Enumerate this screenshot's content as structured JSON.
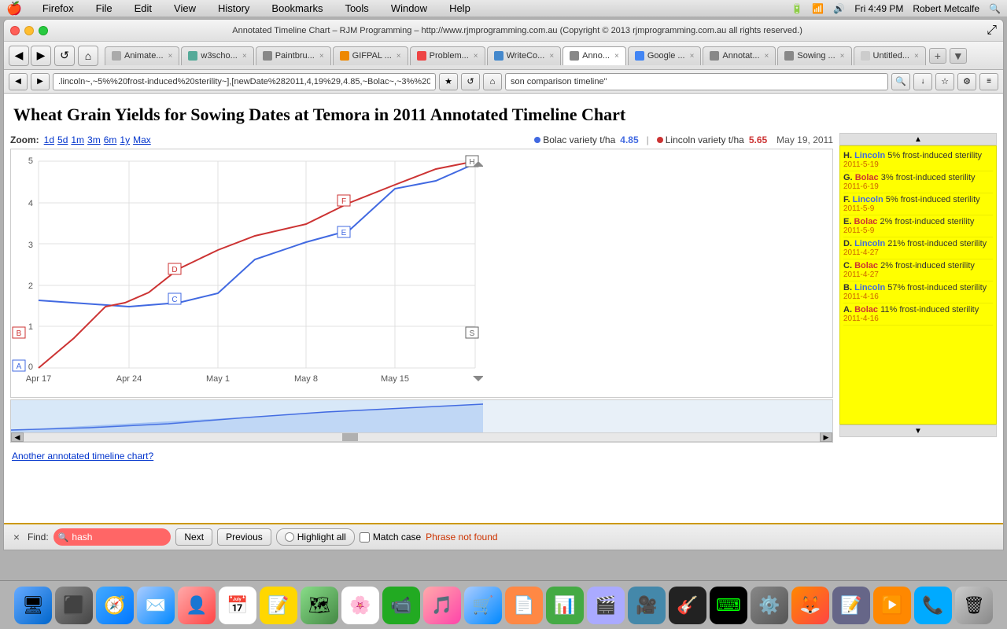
{
  "menubar": {
    "apple": "⌘",
    "items": [
      "Firefox",
      "File",
      "Edit",
      "View",
      "History",
      "Bookmarks",
      "Tools",
      "Window",
      "Help"
    ],
    "right": {
      "time": "Fri 4:49 PM",
      "user": "Robert Metcalfe"
    }
  },
  "window": {
    "title": "Annotated Timeline Chart – RJM Programming – http://www.rjmprogramming.com.au (Copyright © 2013 rjmprogramming.com.au all rights reserved.)"
  },
  "tabs": [
    {
      "label": "Animate...",
      "active": false
    },
    {
      "label": "w3scho...",
      "active": false
    },
    {
      "label": "Paintbru...",
      "active": false
    },
    {
      "label": "GIFPAL ...",
      "active": false
    },
    {
      "label": "Problem...",
      "active": false
    },
    {
      "label": "WriteCo...",
      "active": false
    },
    {
      "label": "Anno...",
      "active": true
    },
    {
      "label": "Google ...",
      "active": false
    },
    {
      "label": "Annotat...",
      "active": false
    },
    {
      "label": "Sowing ...",
      "active": false
    },
    {
      "label": "Untitled...",
      "active": false
    }
  ],
  "address_bar": {
    "url": ".lincoln~,~5%%20frost-induced%20sterility~],[newDate%282011,4,19%29,4.85,~Bolac~,~3%%20frost-induced%20ste",
    "search": "son comparison timeline\""
  },
  "page": {
    "heading": "Wheat Grain Yields for Sowing Dates at Temora in 2011 Annotated Timeline Chart",
    "zoom_label": "Zoom:",
    "zoom_options": [
      "1d",
      "5d",
      "1m",
      "3m",
      "6m",
      "1y",
      "Max"
    ],
    "legend": {
      "bolac_label": "Bolac variety t/ha",
      "bolac_value": "4.85",
      "lincoln_label": "Lincoln variety t/ha",
      "lincoln_value": "5.65",
      "date": "May 19, 2011"
    },
    "chart": {
      "y_axis_labels": [
        "0",
        "1",
        "2",
        "3",
        "4",
        "5"
      ],
      "x_axis_labels": [
        "Apr 17",
        "Apr 24",
        "May 1",
        "May 8",
        "May 15"
      ],
      "annotation_points": [
        "A",
        "B",
        "C",
        "D",
        "E",
        "F",
        "S",
        "H"
      ]
    },
    "annotations": [
      {
        "letter": "H.",
        "variety": "Lincoln",
        "variety_type": "lincoln",
        "desc": "5% frost-induced sterility",
        "date": "2011-5-19"
      },
      {
        "letter": "G.",
        "variety": "Bolac",
        "variety_type": "bolac",
        "desc": "3% frost-induced sterility",
        "date": "2011-6-19"
      },
      {
        "letter": "F.",
        "variety": "Lincoln",
        "variety_type": "lincoln",
        "desc": "5% frost-induced sterility",
        "date": "2011-5-9"
      },
      {
        "letter": "E.",
        "variety": "Bolac",
        "variety_type": "bolac",
        "desc": "2% frost-induced sterility",
        "date": "2011-5-9"
      },
      {
        "letter": "D.",
        "variety": "Lincoln",
        "variety_type": "lincoln",
        "desc": "21% frost-induced sterility",
        "date": "2011-4-27"
      },
      {
        "letter": "C.",
        "variety": "Bolac",
        "variety_type": "bolac",
        "desc": "2% frost-induced sterility",
        "date": "2011-4-27"
      },
      {
        "letter": "B.",
        "variety": "Lincoln",
        "variety_type": "lincoln",
        "desc": "57% frost-induced sterility",
        "date": "2011-4-16"
      },
      {
        "letter": "A.",
        "variety": "Bolac",
        "variety_type": "bolac",
        "desc": "11% frost-induced sterility",
        "date": "2011-4-16"
      }
    ],
    "footer_link": "Another annotated timeline chart?"
  },
  "findbar": {
    "close_label": "×",
    "find_label": "Find:",
    "search_value": "hash",
    "next_label": "Next",
    "previous_label": "Previous",
    "highlight_all_label": "Highlight all",
    "match_case_label": "Match case",
    "status": "Phrase not found"
  }
}
